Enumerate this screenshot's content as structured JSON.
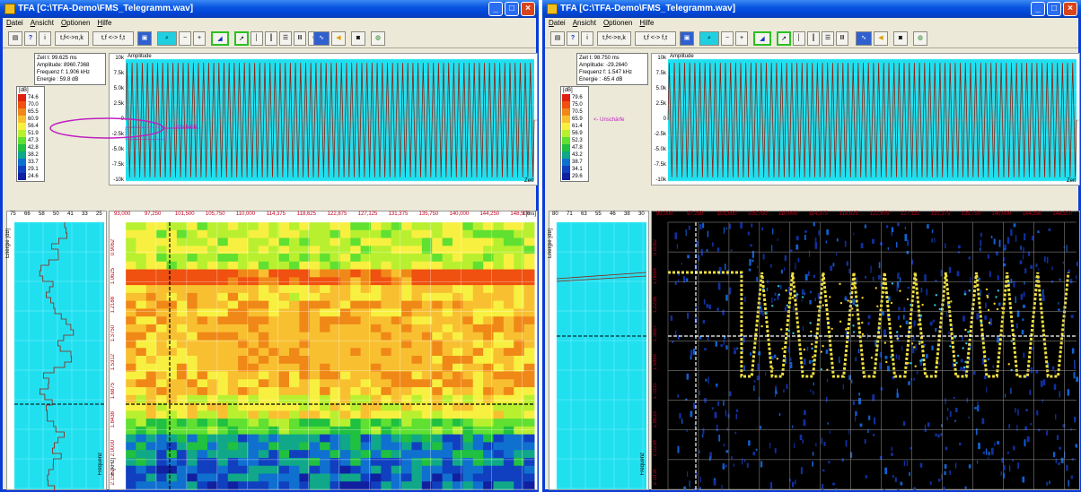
{
  "windows": [
    {
      "title": "TFA [C:\\TFA-Demo\\FMS_Telegramm.wav]",
      "menu": [
        "Datei",
        "Ansicht",
        "Optionen",
        "Hilfe"
      ],
      "toolbar": {
        "tfk_label": "t,f<->n,k",
        "tf_label": "t,f <-> f,t"
      },
      "info": {
        "time": "Zeit t: 99.625 ms",
        "amplitude": "Amplitude: 8960.7368",
        "frequency": "Frequenz f: 1.906 kHz",
        "energy": "Energie : 59.8 dB"
      },
      "legend": {
        "unit": "[dB]",
        "entries": [
          {
            "value": "74.6",
            "color": "#e02010"
          },
          {
            "value": "70.0",
            "color": "#f05010"
          },
          {
            "value": "65.5",
            "color": "#f08818"
          },
          {
            "value": "60.9",
            "color": "#f8c030"
          },
          {
            "value": "56.4",
            "color": "#f8f040"
          },
          {
            "value": "51.9",
            "color": "#b8f030"
          },
          {
            "value": "47.3",
            "color": "#60e030"
          },
          {
            "value": "42.8",
            "color": "#20c040"
          },
          {
            "value": "38.2",
            "color": "#10a888"
          },
          {
            "value": "33.7",
            "color": "#1070d0"
          },
          {
            "value": "29.1",
            "color": "#1040c0"
          },
          {
            "value": "24.6",
            "color": "#1020a0"
          }
        ]
      },
      "amplitude_panel": {
        "label": "Amplitude",
        "yticks": [
          "10k",
          "7.5k",
          "5.0k",
          "2.5k",
          "0",
          "-2.5k",
          "-5.0k",
          "-7.5k",
          "-10k"
        ],
        "xlabel": "Zeit"
      },
      "unschaerfe_label": "Unschärfe",
      "energy_panel": {
        "xticks": [
          "75",
          "66",
          "58",
          "50",
          "41",
          "33",
          "25"
        ],
        "label": "Energie [dB]",
        "freq_label": "Frequenz"
      },
      "time_axis": {
        "ticks": [
          "93,000",
          "97,250",
          "101,500",
          "105,750",
          "110,000",
          "114,375",
          "118,625",
          "122,875",
          "127,125",
          "131,375",
          "135,750",
          "140,000",
          "144,250",
          "148,500"
        ],
        "unit": "t [ms]"
      },
      "freq_axis": {
        "ticks": [
          "0.9062",
          "1.0625",
          "1.2188",
          "1.3750",
          "1.5312",
          "1.6875",
          "1.8438",
          "2.0000",
          "2.1562"
        ],
        "unit": "F [kHz]"
      }
    },
    {
      "title": "TFA [C:\\TFA-Demo\\FMS_Telegramm.wav]",
      "menu": [
        "Datei",
        "Ansicht",
        "Optionen",
        "Hilfe"
      ],
      "toolbar": {
        "tfk_label": "t,f<->n,k",
        "tf_label": "t,f <-> f,t"
      },
      "info": {
        "time": "Zeit t: 98.750 ms",
        "amplitude": "Amplitude: -29.2640",
        "frequency": "Frequenz f: 1.547 kHz",
        "energy": "Energie : -65.4 dB"
      },
      "legend": {
        "unit": "[dB]",
        "entries": [
          {
            "value": "79.6",
            "color": "#e02010"
          },
          {
            "value": "75.0",
            "color": "#f05010"
          },
          {
            "value": "70.5",
            "color": "#f08818"
          },
          {
            "value": "65.9",
            "color": "#f8c030"
          },
          {
            "value": "61.4",
            "color": "#f8f040"
          },
          {
            "value": "56.9",
            "color": "#b8f030"
          },
          {
            "value": "52.3",
            "color": "#60e030"
          },
          {
            "value": "47.8",
            "color": "#20c040"
          },
          {
            "value": "43.2",
            "color": "#10a888"
          },
          {
            "value": "38.7",
            "color": "#1070d0"
          },
          {
            "value": "34.1",
            "color": "#1040c0"
          },
          {
            "value": "29.6",
            "color": "#1020a0"
          }
        ]
      },
      "amplitude_panel": {
        "label": "Amplitude",
        "yticks": [
          "10k",
          "7.5k",
          "5.0k",
          "2.5k",
          "0",
          "-2.5k",
          "-5.0k",
          "-7.5k",
          "-10k"
        ],
        "xlabel": "Zeit"
      },
      "unschaerfe_label": "<- Unschärfe",
      "energy_panel": {
        "xticks": [
          "80",
          "71",
          "63",
          "55",
          "46",
          "38",
          "30"
        ],
        "label": "Energie [dB]",
        "freq_label": "Frequenz"
      },
      "time_axis": {
        "ticks": [
          "93,000",
          "97,250",
          "101,500",
          "105,750",
          "110,000",
          "114,375",
          "118,625",
          "122,875",
          "127,125",
          "131,375",
          "135,750",
          "140,000",
          "144,250",
          "148,500"
        ],
        "unit": "t [ms]"
      },
      "freq_axis": {
        "ticks": [
          "0.9062",
          "1.0664",
          "1.2256",
          "1.3867",
          "1.5469",
          "1.7031",
          "1.8633",
          "2.0234",
          "2.1836"
        ],
        "unit": "F [kHz]"
      }
    }
  ]
}
